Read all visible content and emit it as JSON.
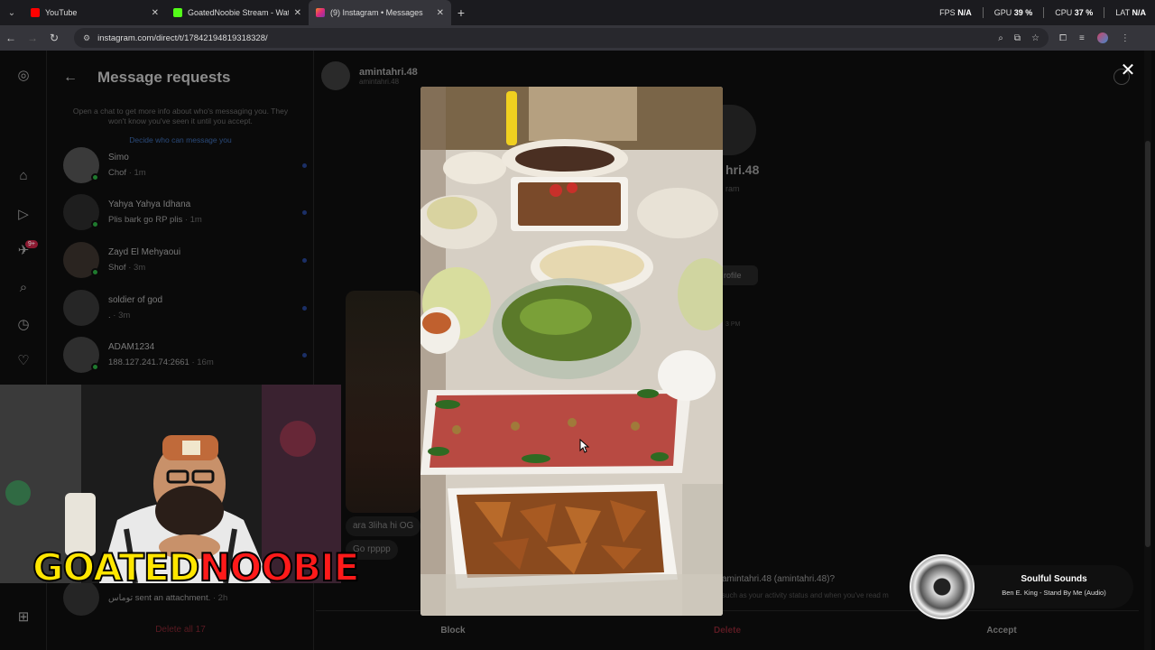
{
  "browser": {
    "tabs": [
      {
        "title": "YouTube",
        "favicon_color": "#ff0000",
        "active": false
      },
      {
        "title": "GoatedNoobie Stream - Watch",
        "favicon_color": "#53fc18",
        "active": false
      },
      {
        "title": "(9) Instagram • Messages",
        "favicon_color": "#e1306c",
        "active": true
      }
    ],
    "new_tab": "+",
    "url": "instagram.com/direct/t/17842194819318328/",
    "stats": {
      "fps_label": "FPS",
      "fps_value": "N/A",
      "gpu_label": "GPU",
      "gpu_value": "39 %",
      "cpu_label": "CPU",
      "cpu_value": "37 %",
      "lat_label": "LAT",
      "lat_value": "N/A"
    }
  },
  "instagram": {
    "requests": {
      "title": "Message requests",
      "info": "Open a chat to get more info about who's messaging you. They won't know you've seen it until you accept.",
      "link": "Decide who can message you",
      "items": [
        {
          "name": "Simo",
          "message": "Chof",
          "time": "· 1m"
        },
        {
          "name": "Yahya Yahya Idhana",
          "message": "Plis bark go RP plis",
          "time": "· 1m"
        },
        {
          "name": "Zayd El Mehyaoui",
          "message": "Shof",
          "time": "· 3m"
        },
        {
          "name": "soldier of god",
          "message": ".",
          "time": "· 3m"
        },
        {
          "name": "ADAM1234",
          "message": "188.127.241.74:2661",
          "time": "· 16m"
        }
      ],
      "last_item": {
        "message": "توماس sent an attachment.",
        "time": "· 2h"
      },
      "delete_all": "Delete all 17"
    },
    "conversation": {
      "username": "amintahri.48",
      "handle": "amintahri.48",
      "profile_name": "hri.48",
      "profile_sub": "ram",
      "profile_button": "rofile",
      "time": "3 PM",
      "bubble_1": "ara 3liha hi OG",
      "bubble_2": "Go rpppp",
      "request_question": "amintahri.48 (amintahri.48)?",
      "request_sub": "such as your activity status and when you've read m"
    },
    "actions": {
      "block": "Block",
      "delete": "Delete",
      "accept": "Accept"
    }
  },
  "viewer": {
    "close": "✕"
  },
  "stream": {
    "logo_part1": "GOATED",
    "logo_part2": "NOOBIE",
    "now_playing_title": "Soulful Sounds",
    "now_playing_track": "Ben E. King - Stand By Me (Audio)"
  }
}
